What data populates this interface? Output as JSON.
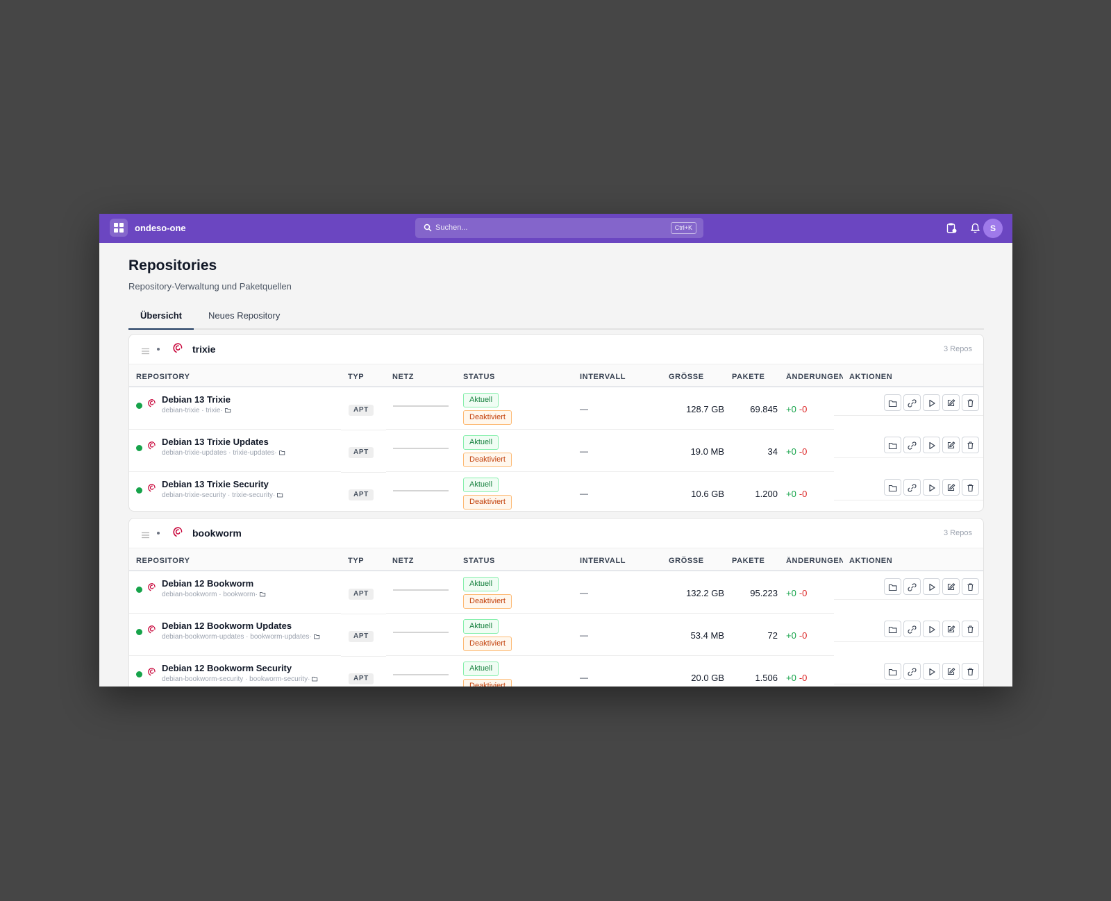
{
  "app": {
    "name": "ondeso-one"
  },
  "search": {
    "placeholder": "Suchen...",
    "shortcut": "Ctrl+K"
  },
  "user": {
    "initial": "S"
  },
  "page": {
    "title": "Repositories",
    "subtitle": "Repository-Verwaltung und Paketquellen",
    "tabs": [
      {
        "label": "Übersicht",
        "active": true
      },
      {
        "label": "Neues Repository",
        "active": false
      }
    ]
  },
  "columns": {
    "repository": "REPOSITORY",
    "typ": "TYP",
    "netz": "NETZ",
    "status": "STATUS",
    "intervall": "INTERVALL",
    "groesse": "GRÖSSE",
    "pakete": "PAKETE",
    "aenderungen": "ÄNDERUNGEN",
    "aktionen": "AKTIONEN"
  },
  "groups": [
    {
      "name": "trixie",
      "count": "3 Repos",
      "rows": [
        {
          "name": "Debian 13 Trixie",
          "sub": "debian-trixie · trixie·",
          "type": "APT",
          "status_ok": "Aktuell",
          "status_off": "Deaktiviert",
          "interval": "—",
          "size": "128.7 GB",
          "packages": "69.845",
          "added": "+0",
          "removed": "-0"
        },
        {
          "name": "Debian 13 Trixie Updates",
          "sub": "debian-trixie-updates · trixie-updates·",
          "type": "APT",
          "status_ok": "Aktuell",
          "status_off": "Deaktiviert",
          "interval": "—",
          "size": "19.0 MB",
          "packages": "34",
          "added": "+0",
          "removed": "-0"
        },
        {
          "name": "Debian 13 Trixie Security",
          "sub": "debian-trixie-security · trixie-security·",
          "type": "APT",
          "status_ok": "Aktuell",
          "status_off": "Deaktiviert",
          "interval": "—",
          "size": "10.6 GB",
          "packages": "1.200",
          "added": "+0",
          "removed": "-0"
        }
      ]
    },
    {
      "name": "bookworm",
      "count": "3 Repos",
      "rows": [
        {
          "name": "Debian 12 Bookworm",
          "sub": "debian-bookworm · bookworm·",
          "type": "APT",
          "status_ok": "Aktuell",
          "status_off": "Deaktiviert",
          "interval": "—",
          "size": "132.2 GB",
          "packages": "95.223",
          "added": "+0",
          "removed": "-0"
        },
        {
          "name": "Debian 12 Bookworm Updates",
          "sub": "debian-bookworm-updates · bookworm-updates·",
          "type": "APT",
          "status_ok": "Aktuell",
          "status_off": "Deaktiviert",
          "interval": "—",
          "size": "53.4 MB",
          "packages": "72",
          "added": "+0",
          "removed": "-0"
        },
        {
          "name": "Debian 12 Bookworm Security",
          "sub": "debian-bookworm-security · bookworm-security·",
          "type": "APT",
          "status_ok": "Aktuell",
          "status_off": "Deaktiviert",
          "interval": "—",
          "size": "20.0 GB",
          "packages": "1.506",
          "added": "+0",
          "removed": "-0"
        }
      ]
    }
  ],
  "colors": {
    "header": "#6b46c1",
    "ok": "#16a34a",
    "removed": "#dc2626",
    "debian": "#c70036"
  }
}
